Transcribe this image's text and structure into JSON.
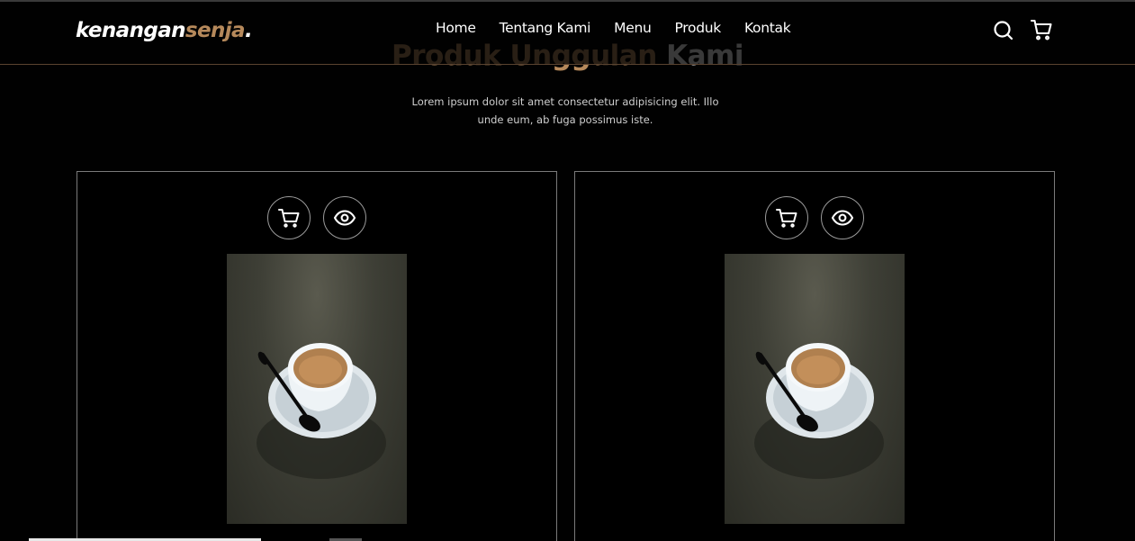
{
  "brand": {
    "part1": "kenangan",
    "part2": "senja",
    "part3": "."
  },
  "nav": {
    "links": [
      "Home",
      "Tentang Kami",
      "Menu",
      "Produk",
      "Kontak"
    ]
  },
  "icons": {
    "search": "search-icon",
    "cart": "cart-icon",
    "view": "eye-icon"
  },
  "section": {
    "title_accent": "Produk Unggulan",
    "title_rest": "Kami",
    "description": "Lorem ipsum dolor sit amet consectetur adipisicing elit. Illo unde eum, ab fuga possimus iste."
  },
  "colors": {
    "accent": "#b6895b",
    "background": "#010101",
    "text": "#ffffff"
  }
}
